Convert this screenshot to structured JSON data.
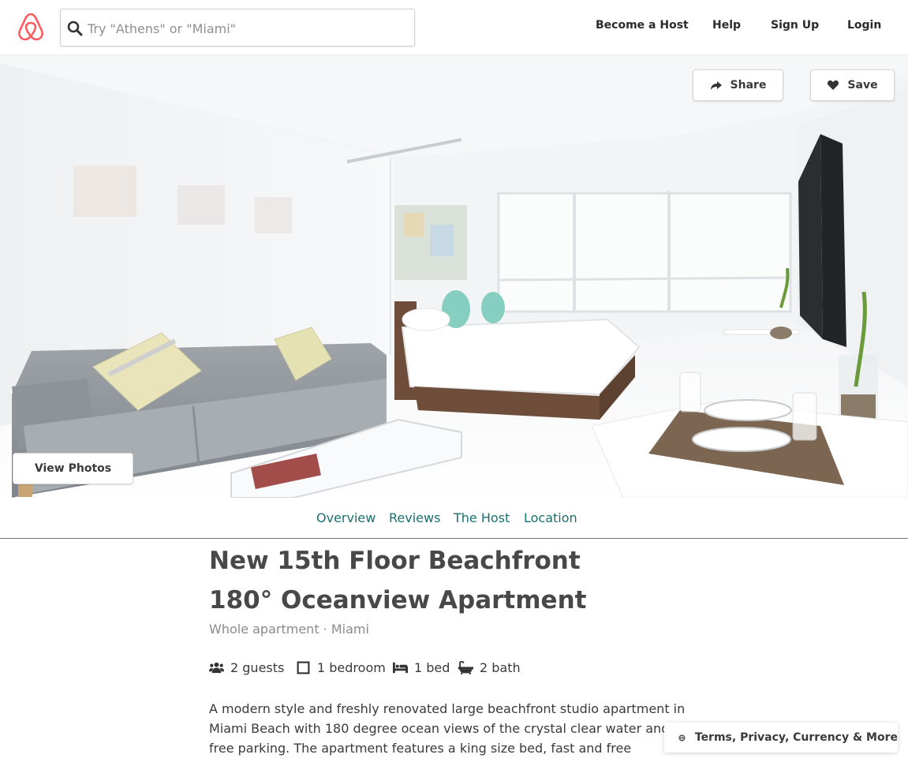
{
  "header": {
    "search": {
      "placeholder": "Try \"Athens\" or \"Miami\"",
      "value": ""
    },
    "nav": [
      "Become a Host",
      "Help",
      "Sign Up",
      "Login"
    ]
  },
  "hero": {
    "share_label": "Share",
    "save_label": "Save",
    "view_photos_label": "View Photos"
  },
  "tabs": [
    "Overview",
    "Reviews",
    "The Host",
    "Location"
  ],
  "listing": {
    "title": "New 15th Floor Beachfront 180° Oceanview Apartment",
    "subtitle": "Whole apartment · Miami",
    "amenities": [
      {
        "icon": "guests-icon",
        "label": "2 guests"
      },
      {
        "icon": "bedroom-icon",
        "label": "1 bedroom"
      },
      {
        "icon": "bed-icon",
        "label": "1 bed"
      },
      {
        "icon": "bath-icon",
        "label": "2 bath"
      }
    ],
    "description": "A modern style and freshly renovated large beachfront studio apartment in Miami Beach with 180 degree ocean views of the crystal clear water and free parking. The apartment features a king size bed, fast and free unlimited"
  },
  "footer": {
    "label": "Terms, Privacy, Currency & More"
  },
  "colors": {
    "brand": "#ff5a5f",
    "tab_link": "#197072",
    "text": "#484848"
  }
}
